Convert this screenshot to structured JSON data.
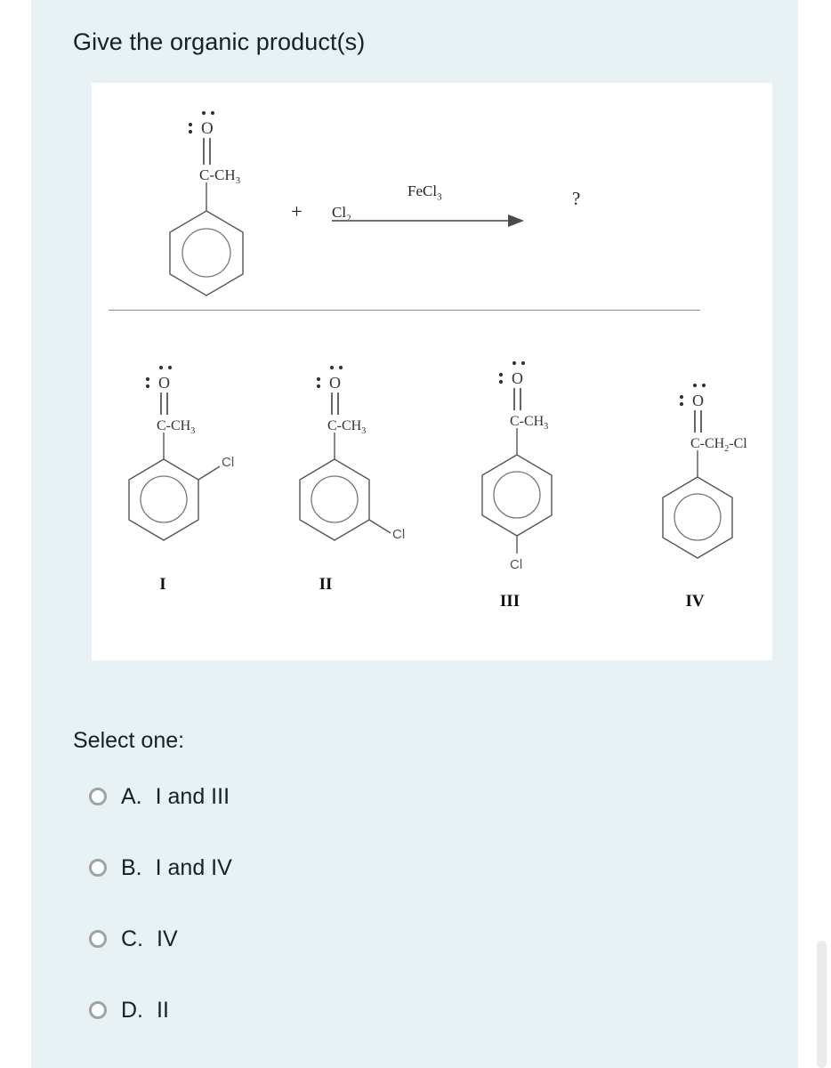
{
  "page": {
    "background_color": "#e8f1f3",
    "card_color": "#ffffff",
    "text_color": "#12222a"
  },
  "question": {
    "title": "Give the organic product(s)"
  },
  "reaction": {
    "reactant": {
      "name": "acetophenone",
      "carbonyl_oxygen": "O",
      "acyl_group": "C-CH",
      "acyl_subscript": "3",
      "ring": "benzene-aromatic-circle"
    },
    "plus": "+",
    "reagent": "Cl",
    "reagent_subscript": "2",
    "catalyst": "FeCl",
    "catalyst_subscript": "3",
    "product_placeholder": "?"
  },
  "products": [
    {
      "label": "I",
      "carbonyl_oxygen": "O",
      "side_chain": "C-CH",
      "side_chain_sub": "3",
      "substituent": "Cl",
      "substituent_position": "ortho"
    },
    {
      "label": "II",
      "carbonyl_oxygen": "O",
      "side_chain": "C-CH",
      "side_chain_sub": "3",
      "substituent": "Cl",
      "substituent_position": "meta"
    },
    {
      "label": "III",
      "carbonyl_oxygen": "O",
      "side_chain": "C-CH",
      "side_chain_sub": "3",
      "substituent": "Cl",
      "substituent_position": "para"
    },
    {
      "label": "IV",
      "carbonyl_oxygen": "O",
      "side_chain": "C-CH",
      "side_chain_sub": "2",
      "side_chain_tail": "-Cl",
      "substituent": "",
      "substituent_position": "side-chain"
    }
  ],
  "answers": {
    "prompt": "Select one:",
    "options": [
      {
        "letter": "A.",
        "text": "I and III",
        "selected": false
      },
      {
        "letter": "B.",
        "text": "I and IV",
        "selected": false
      },
      {
        "letter": "C.",
        "text": "IV",
        "selected": false
      },
      {
        "letter": "D.",
        "text": "II",
        "selected": false
      }
    ]
  }
}
